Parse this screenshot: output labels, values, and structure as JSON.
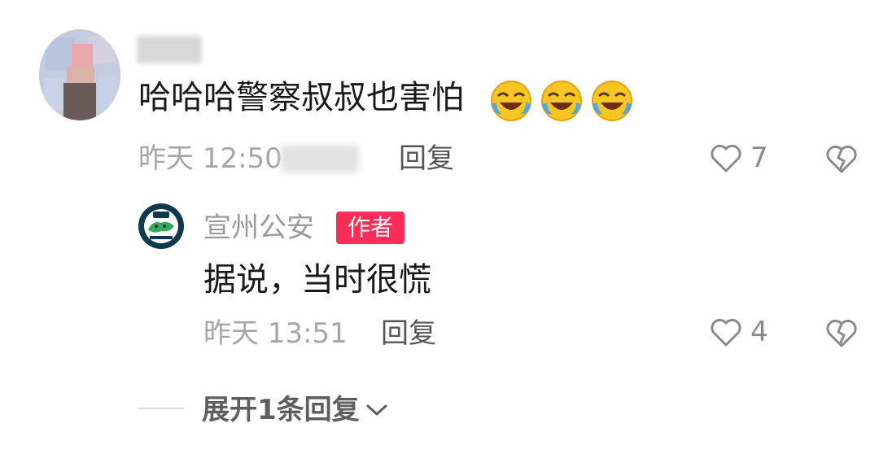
{
  "comment": {
    "text": "哈哈哈警察叔叔也害怕",
    "emoji_icons": [
      "laughing-tears-icon",
      "laughing-tears-icon",
      "laughing-tears-icon"
    ],
    "time_prefix": "昨天 12:50",
    "reply_label": "回复",
    "likes": "7"
  },
  "reply": {
    "author": "宣州公安",
    "badge": "作者",
    "text": "据说，当时很慌",
    "time": "昨天 13:51",
    "reply_label": "回复",
    "likes": "4"
  },
  "expand": {
    "label": "展开1条回复"
  },
  "colors": {
    "badge_bg": "#fb2c55",
    "meta_gray": "#a6a6a6",
    "avatar_dark": "#0f3a4e"
  }
}
